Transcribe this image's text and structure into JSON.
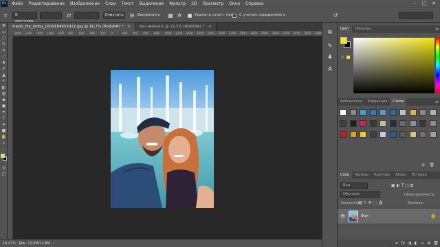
{
  "app": {
    "logo": "Ps"
  },
  "menu": [
    "Файл",
    "Редактирование",
    "Изображение",
    "Слои",
    "Текст",
    "Выделение",
    "Фильтр",
    "3D",
    "Просмотр",
    "Окно",
    "Справка"
  ],
  "window_controls": [
    "–",
    "□",
    "✕"
  ],
  "options": {
    "mode_value": "В светлова...",
    "clear_label": "Очистить",
    "straighten_label": "Выпрямить",
    "delete_cropped_label": "Удалить отсеч. пикс.",
    "content_aware_label": "С учетом содержимого"
  },
  "tabs": [
    {
      "label": "mwdn_file_temp_1609184955922.jpg @ 16,7% (RGB/8#) *",
      "close": "×"
    },
    {
      "label": "Без имени-1 @ 12,5% (RGB/8#) *",
      "close": "×"
    }
  ],
  "ruler_top_ticks": [
    "1800",
    "1600",
    "1400",
    "1200",
    "1000",
    "800",
    "600",
    "400",
    "200",
    "0",
    "200",
    "400",
    "600",
    "800",
    "1000",
    "1200",
    "1400",
    "1600",
    "1800",
    "2000",
    "2200",
    "2400",
    "2600",
    "2800",
    "3000",
    "3200",
    "3400",
    "3600",
    "3800"
  ],
  "status": {
    "zoom": "16,47%",
    "doc": "Док: 12,8М/12,8М",
    "arrow": "›"
  },
  "color_panel": {
    "tabs": [
      "Цвет",
      "Образцы"
    ],
    "fg_color": "#f4e61a",
    "bg_color": "#000000"
  },
  "styles_panel": {
    "tabs": [
      "Библиотеки",
      "Коррекция",
      "Стили"
    ]
  },
  "layers_panel": {
    "tabs": [
      "Слои",
      "Каналы",
      "Контуры",
      "Абзац",
      "История"
    ],
    "kind_placeholder": "Вид",
    "blend_mode": "Обычные",
    "opacity_label": "Непрозрачность:",
    "lock_label": "Закрепить:",
    "fill_label": "Заливка:",
    "layer_name": "Фон"
  },
  "accent": "#f4e61a"
}
